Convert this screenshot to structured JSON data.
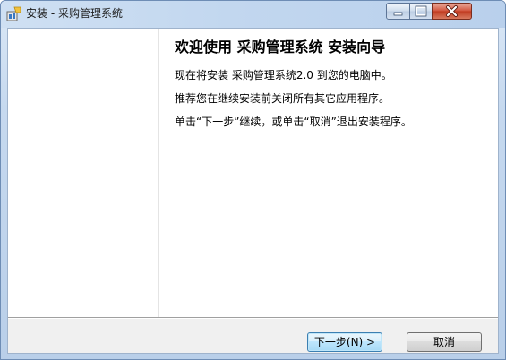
{
  "window": {
    "title": "安装 - 采购管理系统",
    "controls": {
      "minimize": "minimize",
      "maximize": "maximize",
      "close": "close"
    }
  },
  "wizard": {
    "heading": "欢迎使用 采购管理系统 安装向导",
    "paragraphs": [
      "现在将安装 采购管理系统2.0 到您的电脑中。",
      "推荐您在继续安装前关闭所有其它应用程序。",
      "单击“下一步”继续，或单击“取消”退出安装程序。"
    ]
  },
  "buttons": {
    "next": "下一步(N) >",
    "cancel": "取消"
  },
  "colors": {
    "titlebar": "#c6d9ef",
    "close_button": "#c94a2f",
    "default_button_border": "#3c7fb1"
  },
  "icons": [
    "installer-app-icon",
    "minimize-icon",
    "maximize-icon",
    "close-icon"
  ]
}
